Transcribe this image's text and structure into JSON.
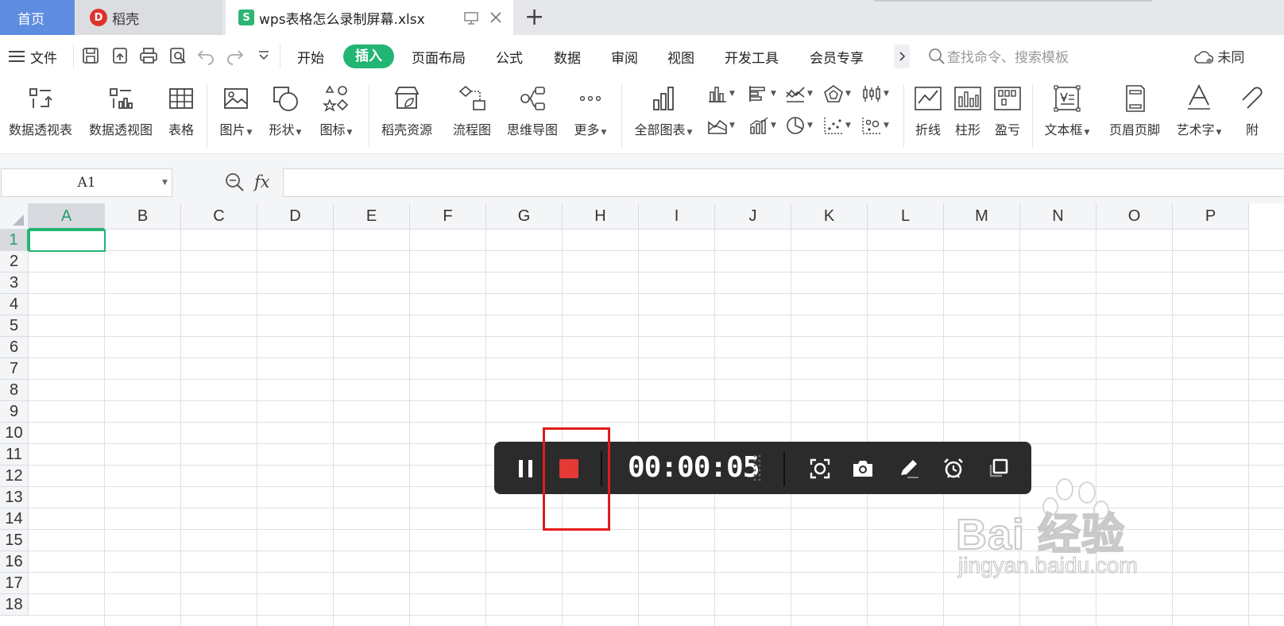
{
  "tabs": {
    "home": "首页",
    "daoke": "稻壳",
    "daoke_logo": "D",
    "file_logo": "S",
    "file": "wps表格怎么录制屏幕.xlsx",
    "add": "+"
  },
  "menu": {
    "file_label": "文件",
    "items": [
      "开始",
      "插入",
      "页面布局",
      "公式",
      "数据",
      "审阅",
      "视图",
      "开发工具",
      "会员专享"
    ],
    "search_placeholder": "查找命令、搜索模板",
    "cloud_label": "未同"
  },
  "ribbon": {
    "groups": [
      {
        "label": "数据透视表",
        "icon": "pivot-table-icon"
      },
      {
        "label": "数据透视图",
        "icon": "pivot-chart-icon"
      },
      {
        "label": "表格",
        "icon": "table-icon"
      },
      {
        "label": "图片",
        "icon": "picture-icon",
        "dropdown": true
      },
      {
        "label": "形状",
        "icon": "shape-icon",
        "dropdown": true
      },
      {
        "label": "图标",
        "icon": "icons-icon",
        "dropdown": true
      },
      {
        "label": "稻壳资源",
        "icon": "daoke-resource-icon"
      },
      {
        "label": "流程图",
        "icon": "flowchart-icon"
      },
      {
        "label": "思维导图",
        "icon": "mindmap-icon"
      },
      {
        "label": "更多",
        "icon": "more-icon",
        "dropdown": true
      },
      {
        "label": "全部图表",
        "icon": "all-charts-icon",
        "dropdown": true
      },
      {
        "label": "折线",
        "icon": "sparkline-line-icon"
      },
      {
        "label": "柱形",
        "icon": "sparkline-column-icon"
      },
      {
        "label": "盈亏",
        "icon": "sparkline-winloss-icon"
      },
      {
        "label": "文本框",
        "icon": "textbox-icon",
        "dropdown": true
      },
      {
        "label": "页眉页脚",
        "icon": "header-footer-icon"
      },
      {
        "label": "艺术字",
        "icon": "wordart-icon",
        "dropdown": true
      },
      {
        "label": "附",
        "icon": "attachment-icon"
      }
    ]
  },
  "formula": {
    "name_box": "A1",
    "fx": "fx"
  },
  "grid": {
    "columns": [
      "A",
      "B",
      "C",
      "D",
      "E",
      "F",
      "G",
      "H",
      "I",
      "J",
      "K",
      "L",
      "M",
      "N",
      "O",
      "P"
    ],
    "rows": [
      "1",
      "2",
      "3",
      "4",
      "5",
      "6",
      "7",
      "8",
      "9",
      "10",
      "11",
      "12",
      "13",
      "14",
      "15",
      "16",
      "17",
      "18"
    ],
    "active_column": "A",
    "active_row": "1"
  },
  "recorder": {
    "time": "00:00:05"
  },
  "watermark": {
    "text": "Bai 经验",
    "sub": "jingyan.baidu.com"
  },
  "colors": {
    "accent": "#22b573",
    "highlight": "#e21b1b",
    "stop": "#e53935"
  }
}
